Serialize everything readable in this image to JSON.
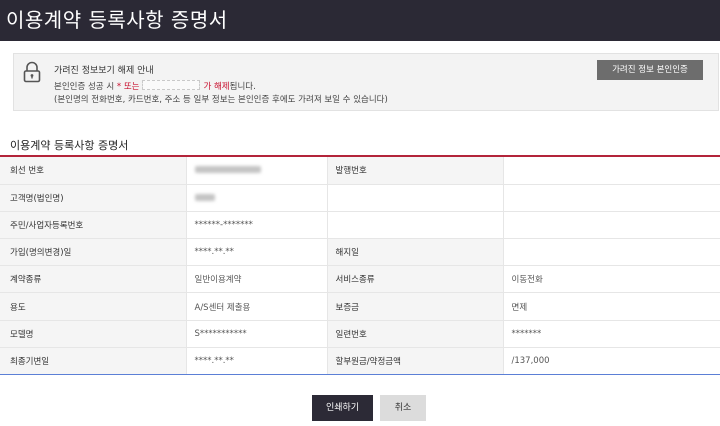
{
  "page": {
    "title": "이용계약 등록사항 증명서"
  },
  "notice": {
    "icon": "lock-icon",
    "title": "가려진 정보보기 해제 안내",
    "line1_prefix": "본인인증 성공 시",
    "line1_star": "*",
    "line1_or": "또는",
    "line1_highlight": "가 해제",
    "line1_suffix": "됩니다.",
    "line2": "(본인명의 전화번호, 카드번호, 주소 등 일부 정보는 본인인증 후에도 가려져 보일 수 있습니다)",
    "button_label": "가려진 정보 본인인증"
  },
  "section": {
    "title": "이용계약 등록사항 증명서"
  },
  "table": {
    "rows": [
      {
        "label1": "회선 번호",
        "value1": "",
        "label2": "발행번호",
        "value2": ""
      },
      {
        "label1": "고객명(법인명)",
        "value1": "",
        "label2": "",
        "value2": ""
      },
      {
        "label1": "주민/사업자등록번호",
        "value1": "******-*******",
        "label2": "",
        "value2": ""
      },
      {
        "label1": "가입(명의변경)일",
        "value1": "****.**.**",
        "label2": "해지일",
        "value2": ""
      },
      {
        "label1": "계약종류",
        "value1": "일반이용계약",
        "label2": "서비스종류",
        "value2": "이동전화"
      },
      {
        "label1": "용도",
        "value1": "A/S센터 제출용",
        "label2": "보증금",
        "value2": "면제"
      },
      {
        "label1": "모델명",
        "value1": "S***********",
        "label2": "일련번호",
        "value2": "*******"
      },
      {
        "label1": "최종기변일",
        "value1": "****.**.**",
        "label2": "할부원금/약정금액",
        "value2": "/137,000"
      }
    ]
  },
  "actions": {
    "print_label": "인쇄하기",
    "cancel_label": "취소"
  },
  "colors": {
    "titlebar": "#2b2935",
    "accent_red": "#c8102e",
    "rule": "#b3243a"
  }
}
